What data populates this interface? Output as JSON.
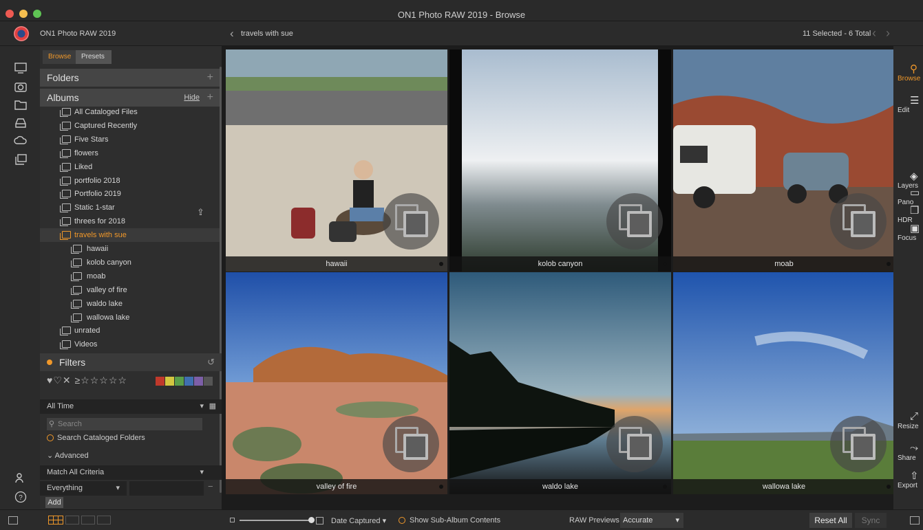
{
  "window": {
    "title": "ON1 Photo RAW 2019 - Browse"
  },
  "appbar": {
    "app_name": "ON1 Photo RAW 2019",
    "breadcrumb": "travels with sue",
    "selection": "11 Selected - 6 Total"
  },
  "panel": {
    "tabs": [
      "Browse",
      "Presets"
    ],
    "folders_label": "Folders",
    "albums_label": "Albums",
    "hide_label": "Hide",
    "albums": [
      {
        "label": "All Cataloged Files",
        "indent": 0
      },
      {
        "label": "Captured Recently",
        "indent": 0
      },
      {
        "label": "Five Stars",
        "indent": 0
      },
      {
        "label": "flowers",
        "indent": 0
      },
      {
        "label": "Liked",
        "indent": 0
      },
      {
        "label": "portfolio 2018",
        "indent": 0
      },
      {
        "label": "Portfolio 2019",
        "indent": 0
      },
      {
        "label": "Static 1-star",
        "indent": 0
      },
      {
        "label": "threes for 2018",
        "indent": 0
      },
      {
        "label": "travels with sue",
        "indent": 0,
        "selected": true
      },
      {
        "label": "hawaii",
        "indent": 1
      },
      {
        "label": "kolob canyon",
        "indent": 1
      },
      {
        "label": "moab",
        "indent": 1
      },
      {
        "label": "valley of fire",
        "indent": 1
      },
      {
        "label": "waldo lake",
        "indent": 1
      },
      {
        "label": "wallowa lake",
        "indent": 1
      },
      {
        "label": "unrated",
        "indent": 0
      },
      {
        "label": "Videos",
        "indent": 0
      }
    ],
    "filters_label": "Filters",
    "ratings_glyphs": "♥♡✕ ≥☆☆☆☆☆",
    "color_swatches": [
      "#c0392b",
      "#d4c640",
      "#5a9d4a",
      "#3f6fb0",
      "#7d5fa8",
      "#555555"
    ],
    "time_filter": "All Time",
    "search_placeholder": "Search",
    "search_cataloged": "Search Cataloged Folders",
    "advanced": "Advanced",
    "match": "Match All Criteria",
    "everything": "Everything",
    "add": "Add"
  },
  "photos": [
    {
      "caption": "hawaii"
    },
    {
      "caption": "kolob canyon"
    },
    {
      "caption": "moab"
    },
    {
      "caption": "valley of fire"
    },
    {
      "caption": "waldo lake"
    },
    {
      "caption": "wallowa lake"
    }
  ],
  "right_rail": [
    {
      "label": "Browse",
      "icon": "browse-icon",
      "active": true
    },
    {
      "label": "Edit",
      "icon": "edit-icon"
    },
    {
      "label": "Layers",
      "icon": "layers-icon"
    },
    {
      "label": "Pano",
      "icon": "pano-icon"
    },
    {
      "label": "HDR",
      "icon": "hdr-icon"
    },
    {
      "label": "Focus",
      "icon": "focus-icon"
    },
    {
      "label": "Resize",
      "icon": "resize-icon"
    },
    {
      "label": "Share",
      "icon": "share-icon"
    },
    {
      "label": "Export",
      "icon": "export-icon"
    }
  ],
  "bottombar": {
    "sort": "Date Captured",
    "show_sub": "Show Sub-Album Contents",
    "raw_previews_label": "RAW Previews",
    "raw_previews_value": "Accurate",
    "reset_all": "Reset All",
    "sync": "Sync"
  },
  "colors": {
    "accent": "#f0982a",
    "panel": "#2e2e2e",
    "grid_bg": "#1c1c1c"
  }
}
